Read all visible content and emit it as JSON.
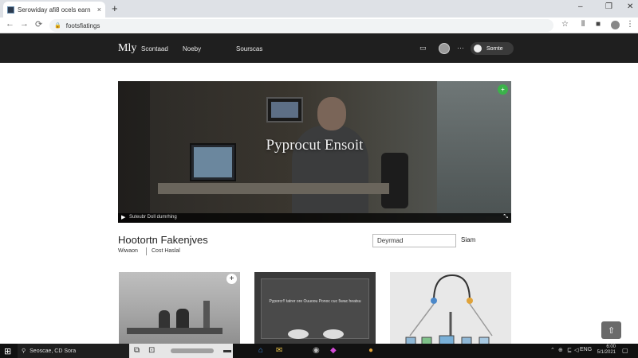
{
  "browser": {
    "tab_title": "Serowiday afi8 ocels earn",
    "tab_close": "×",
    "new_tab": "+",
    "window_controls": [
      "–",
      "❐",
      "✕"
    ],
    "nav": {
      "back": "←",
      "forward": "→",
      "reload": "⟳"
    },
    "url": "footsfiatings",
    "toolbar_icons": {
      "star": "☆",
      "extensions": "⫴",
      "sidebar": "■",
      "menu": "⋮"
    }
  },
  "site": {
    "logo": "Mly",
    "nav": [
      "Scontaad",
      "Noeby",
      "Sourscas"
    ],
    "header_icon": "▭",
    "more": "···",
    "signin_label": "Sornte"
  },
  "hero": {
    "title": "Pyprocut Ensoit",
    "caption": "Suteubr Doll dumrhing",
    "badge": "+",
    "play": "▶",
    "expand": "⤡"
  },
  "section": {
    "title": "Hootortn Fakenjves",
    "subtabs": [
      "Wiwaon",
      "Cost Haslal"
    ],
    "search_value": "Deyrmad",
    "search_button": "Siam"
  },
  "cards": [
    {
      "plus": "+"
    },
    {
      "text": "Pyporcr!! tatrer ore Ouuoou Ponoc cuc 5wac heatsu"
    },
    {}
  ],
  "scroll_top": "⇧",
  "taskbar": {
    "start": "⊞",
    "search_glass": "⚲",
    "search_text": "Seoscae, CD Sora",
    "apps": [
      "⧉",
      "⊡",
      "▬",
      "⌂",
      "✉",
      "◉",
      "◆",
      "●"
    ],
    "tray": [
      "⌃",
      "⊕",
      "⊑",
      "◁",
      "ENG"
    ],
    "clock_time": "6:00",
    "clock_date": "5/1/2021",
    "notification": "▢"
  }
}
